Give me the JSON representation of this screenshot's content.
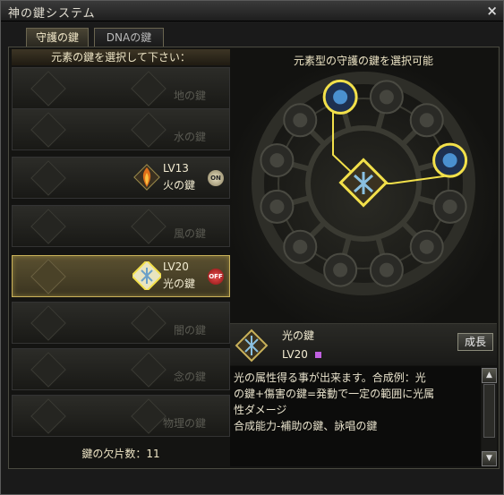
{
  "window": {
    "title": "神の鍵システム",
    "close": "×"
  },
  "tabs": [
    {
      "label": "守護の鍵",
      "active": true
    },
    {
      "label": "DNAの鍵",
      "active": false
    }
  ],
  "left": {
    "header": "元素の鍵を選択して下さい：",
    "slots": [
      {
        "name": "地の鍵",
        "owned": false
      },
      {
        "name": "水の鍵",
        "owned": false
      },
      {
        "name": "火の鍵",
        "owned": true,
        "level": "LV13",
        "toggle": "ON",
        "selected": false
      },
      {
        "name": "風の鍵",
        "owned": false
      },
      {
        "name": "光の鍵",
        "owned": true,
        "level": "LV20",
        "toggle": "OFF",
        "selected": true
      },
      {
        "name": "闇の鍵",
        "owned": false
      },
      {
        "name": "念の鍵",
        "owned": false
      },
      {
        "name": "物理の鍵",
        "owned": false
      }
    ],
    "footer": "鍵の欠片数：11"
  },
  "right": {
    "header": "元素型の守護の鍵を選択可能",
    "center_icon": "light-key-icon",
    "nodes": [
      {
        "icon": "blue-gem-icon",
        "active": true
      },
      {
        "icon": "feather-icon",
        "active": false
      },
      {
        "icon": "clock-icon",
        "active": false
      },
      {
        "icon": "blue-swirl-icon",
        "active": true
      },
      {
        "icon": "claw-icon",
        "active": false
      },
      {
        "icon": "tornado-icon",
        "active": false
      },
      {
        "icon": "wave-icon",
        "active": false
      },
      {
        "icon": "spiral-icon",
        "active": false
      },
      {
        "icon": "eye-icon",
        "active": false
      },
      {
        "icon": "wind-icon",
        "active": false
      },
      {
        "icon": "leaf-icon",
        "active": false
      },
      {
        "icon": "slash-icon",
        "active": false
      }
    ]
  },
  "info": {
    "name": "光の鍵",
    "level": "LV20",
    "grow_button": "成長",
    "description": [
      "光の属性得る事が出来ます。合成例：光",
      "の鍵+傷害の鍵=発動で一定の範囲に光属",
      "性ダメージ",
      "合成能力-補助の鍵、詠唱の鍵"
    ]
  },
  "colors": {
    "gold": "#d4b84a",
    "glow": "#f2e04a",
    "text": "#e8e2cc",
    "off": "#c81e1e"
  }
}
